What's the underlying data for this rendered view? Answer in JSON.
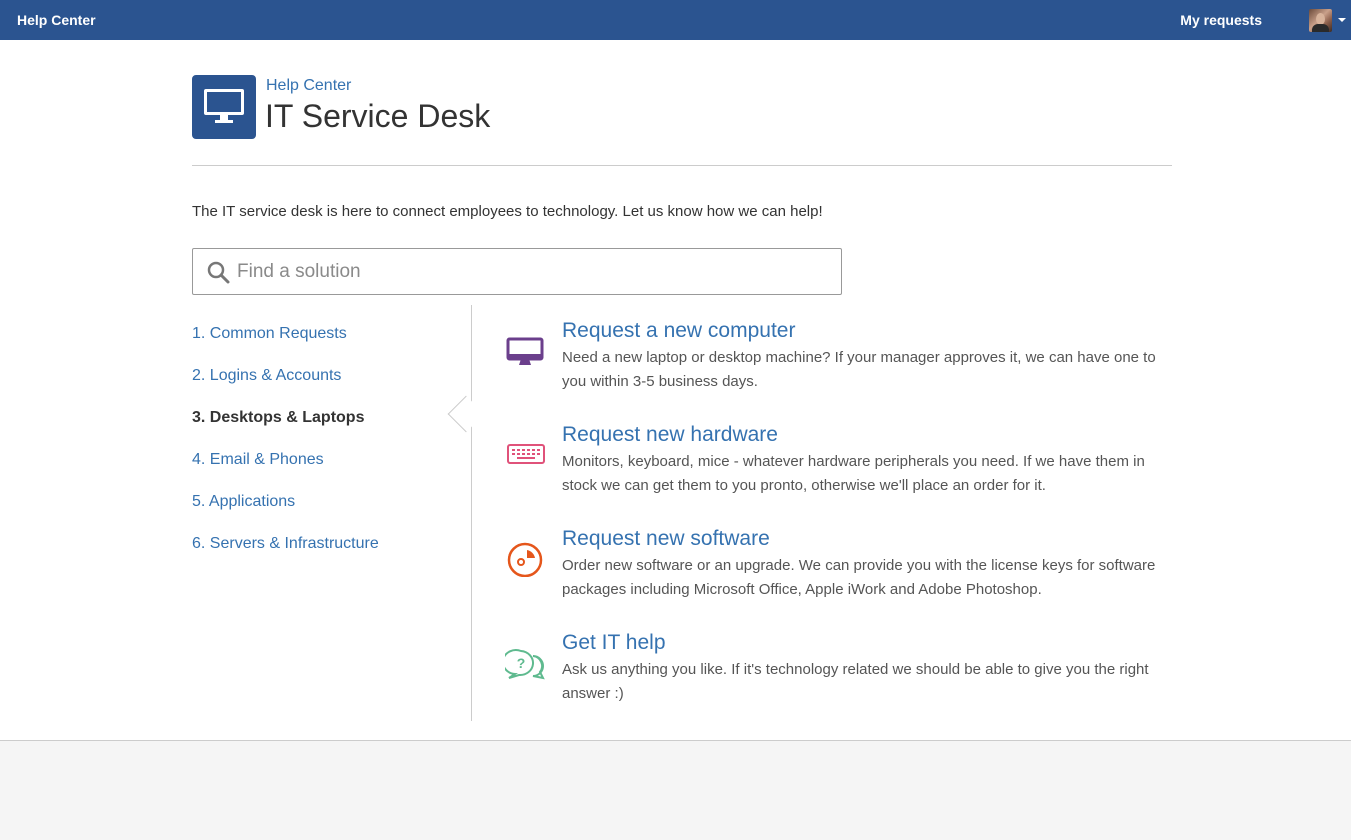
{
  "topbar": {
    "brand": "Help Center",
    "my_requests": "My requests",
    "avatar": "user-avatar"
  },
  "header": {
    "breadcrumb": "Help Center",
    "title": "IT Service Desk",
    "logo_icon": "monitor-icon"
  },
  "intro": "The IT service desk is here to connect employees to technology. Let us know how we can help!",
  "search": {
    "placeholder": "Find a solution",
    "value": ""
  },
  "nav": {
    "items": [
      {
        "label": "1. Common Requests",
        "active": false
      },
      {
        "label": "2. Logins & Accounts",
        "active": false
      },
      {
        "label": "3. Desktops & Laptops",
        "active": true
      },
      {
        "label": "4. Email & Phones",
        "active": false
      },
      {
        "label": "5. Applications",
        "active": false
      },
      {
        "label": "6. Servers & Infrastructure",
        "active": false
      }
    ]
  },
  "requests": [
    {
      "icon": "computer-icon",
      "color": "#6b3f8c",
      "title": "Request a new computer",
      "description": "Need a new laptop or desktop machine? If your manager approves it, we can have one to you within 3-5 business days."
    },
    {
      "icon": "keyboard-icon",
      "color": "#e0527a",
      "title": "Request new hardware",
      "description": "Monitors, keyboard, mice - whatever hardware peripherals you need. If we have them in stock we can get them to you pronto, otherwise we'll place an order for it."
    },
    {
      "icon": "software-disc-icon",
      "color": "#e5561b",
      "title": "Request new software",
      "description": "Order new software or an upgrade. We can provide you with the license keys for software packages including Microsoft Office, Apple iWork and Adobe Photoshop."
    },
    {
      "icon": "help-chat-icon",
      "color": "#5fba8f",
      "title": "Get IT help",
      "description": "Ask us anything you like. If it's technology related we should be able to give you the right answer :)"
    }
  ],
  "colors": {
    "topbar": "#2b5490",
    "link": "#3572b0"
  }
}
